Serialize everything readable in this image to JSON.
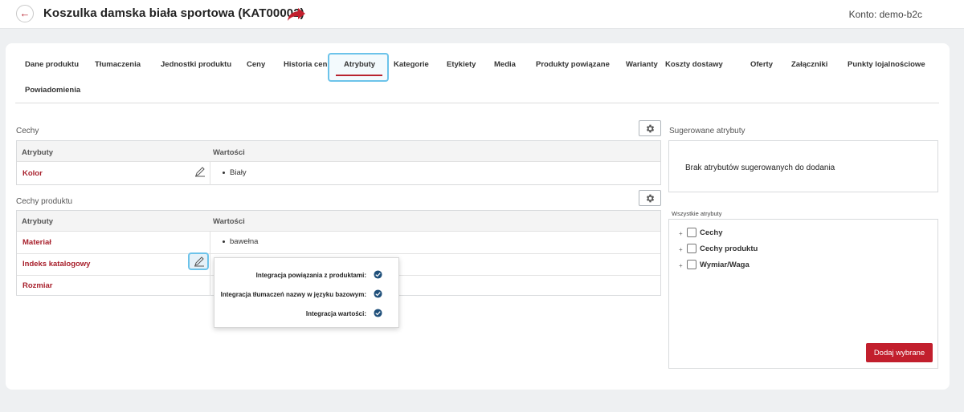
{
  "header": {
    "back_icon": "arrow-left-icon",
    "title": "Koszulka damska biała sportowa (KAT00002)",
    "share_icon": "share-arrow-icon",
    "account": "Konto: demo-b2c"
  },
  "tabs": [
    {
      "label": "Dane produktu"
    },
    {
      "label": "Tłumaczenia"
    },
    {
      "label": "Jednostki produktu"
    },
    {
      "label": "Ceny"
    },
    {
      "label": "Historia cen"
    },
    {
      "label": "Atrybuty",
      "active": true
    },
    {
      "label": "Kategorie"
    },
    {
      "label": "Etykiety"
    },
    {
      "label": "Media"
    },
    {
      "label": "Produkty powiązane"
    },
    {
      "label": "Warianty"
    },
    {
      "label": "Koszty dostawy"
    },
    {
      "label": "Oferty"
    },
    {
      "label": "Załączniki"
    },
    {
      "label": "Punkty lojalnościowe"
    },
    {
      "label": "Powiadomienia"
    }
  ],
  "cechy": {
    "title": "Cechy",
    "col_attr": "Atrybuty",
    "col_values": "Wartości",
    "rows": [
      {
        "name": "Kolor",
        "value": "Biały"
      }
    ]
  },
  "cechy_produktu": {
    "title": "Cechy produktu",
    "col_attr": "Atrybuty",
    "col_values": "Wartości",
    "rows": [
      {
        "name": "Materiał",
        "value": "bawełna"
      },
      {
        "name": "Indeks katalogowy",
        "value": ""
      },
      {
        "name": "Rozmiar",
        "value": ""
      }
    ]
  },
  "popup": {
    "rows": [
      {
        "label": "Integracja powiązania z produktami:",
        "checked": true
      },
      {
        "label": "Integracja tłumaczeń nazwy w języku bazowym:",
        "checked": true
      },
      {
        "label": "Integracja wartości:",
        "checked": true
      }
    ]
  },
  "suggested": {
    "title": "Sugerowane atrybuty",
    "empty_text": "Brak atrybutów sugerowanych do dodania"
  },
  "all_attributes": {
    "title": "Wszystkie atrybuty",
    "items": [
      {
        "label": "Cechy"
      },
      {
        "label": "Cechy produktu"
      },
      {
        "label": "Wymiar/Waga"
      }
    ],
    "add_button": "Dodaj wybrane"
  },
  "colors": {
    "accent": "#b8232f",
    "highlight": "#6cc3ea",
    "check": "#1f4f7a"
  }
}
